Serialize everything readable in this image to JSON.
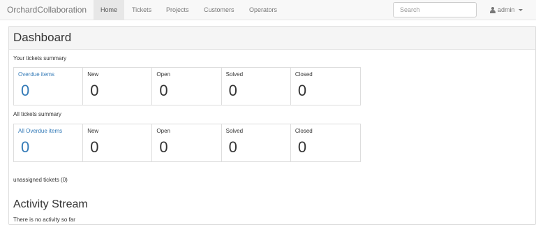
{
  "navbar": {
    "brand": "OrchardCollaboration",
    "items": [
      {
        "label": "Home",
        "active": true
      },
      {
        "label": "Tickets",
        "active": false
      },
      {
        "label": "Projects",
        "active": false
      },
      {
        "label": "Customers",
        "active": false
      },
      {
        "label": "Operators",
        "active": false
      }
    ],
    "search_placeholder": "Search",
    "user": "admin",
    "user_icon": "user-icon"
  },
  "dashboard": {
    "title": "Dashboard",
    "your_summary": {
      "label": "Your tickets summary",
      "cards": [
        {
          "label": "Overdue items",
          "value": "0"
        },
        {
          "label": "New",
          "value": "0"
        },
        {
          "label": "Open",
          "value": "0"
        },
        {
          "label": "Solved",
          "value": "0"
        },
        {
          "label": "Closed",
          "value": "0"
        }
      ]
    },
    "all_summary": {
      "label": "All tickets summary",
      "cards": [
        {
          "label": "All Overdue items",
          "value": "0"
        },
        {
          "label": "New",
          "value": "0"
        },
        {
          "label": "Open",
          "value": "0"
        },
        {
          "label": "Solved",
          "value": "0"
        },
        {
          "label": "Closed",
          "value": "0"
        }
      ]
    },
    "unassigned": "unassigned tickets (0)",
    "activity_title": "Activity Stream",
    "activity_empty": "There is no activity so far"
  },
  "colors": {
    "link": "#337ab7",
    "navbar_bg": "#f8f8f8",
    "active_bg": "#e7e7e7"
  }
}
